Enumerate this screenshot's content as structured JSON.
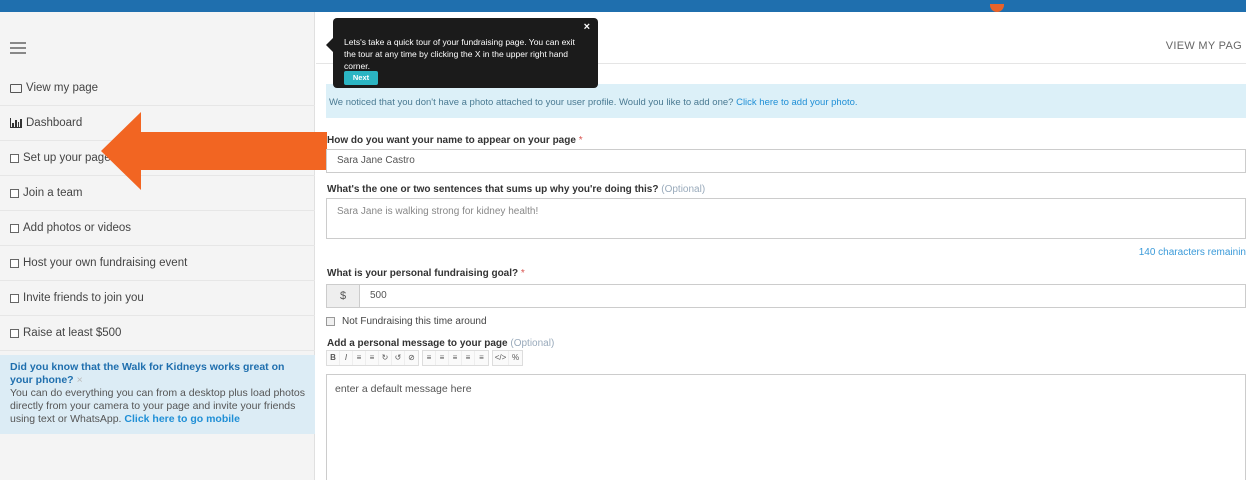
{
  "header": {
    "view_page_link": "VIEW MY PAG"
  },
  "sidebar": {
    "items": [
      {
        "label": "View my page",
        "icon": "monitor-icon"
      },
      {
        "label": "Dashboard",
        "icon": "bar-chart-icon"
      },
      {
        "label": "Set up your page",
        "icon": "checkbox-icon"
      },
      {
        "label": "Join a team",
        "icon": "checkbox-icon"
      },
      {
        "label": "Add photos or videos",
        "icon": "checkbox-icon"
      },
      {
        "label": "Host your own fundraising event",
        "icon": "checkbox-icon"
      },
      {
        "label": "Invite friends to join you",
        "icon": "checkbox-icon"
      },
      {
        "label": "Raise at least $500",
        "icon": "checkbox-icon"
      }
    ],
    "mobile_promo": {
      "title": "Did you know that the Walk for Kidneys works great on your phone?",
      "close": "×",
      "body": "You can do everything you can from a desktop plus load photos directly from your camera to your page and invite your friends using text or WhatsApp.",
      "link": "Click here to go mobile"
    }
  },
  "tour": {
    "text": "Lets's take a quick tour of your fundraising page. You can exit the tour at any time by clicking the X in the upper right hand corner.",
    "next_label": "Next",
    "close": "×"
  },
  "alert": {
    "text": "We noticed that you don't have a photo attached to your user profile. Would you like to add one?",
    "link": "Click here to add your photo."
  },
  "form": {
    "name_label": "How do you want your name to appear on your page",
    "required_mark": "*",
    "name_value": "Sara Jane Castro",
    "summary_label": "What's the one or two sentences that sums up why you're doing this?",
    "optional_mark": "(Optional)",
    "summary_value": "Sara Jane is walking strong for kidney health!",
    "chars_remaining": "140 characters remainin",
    "goal_label": "What is your personal fundraising goal?",
    "currency_symbol": "$",
    "goal_value": "500",
    "not_fundraising_label": "Not Fundraising this time around",
    "message_label": "Add a personal message to your page",
    "message_value": "enter a default message here"
  },
  "toolbar": {
    "groups": [
      [
        "B",
        "I",
        "≡",
        "≡",
        "↻",
        "↺",
        "⊘"
      ],
      [
        "≡",
        "≡",
        "≡",
        "≡",
        "≡"
      ],
      [
        "</>",
        "%"
      ]
    ]
  },
  "colors": {
    "topbar": "#1f6fae",
    "arrow": "#f26522",
    "link": "#1f8fd6",
    "tour_next": "#2bb5c3"
  }
}
